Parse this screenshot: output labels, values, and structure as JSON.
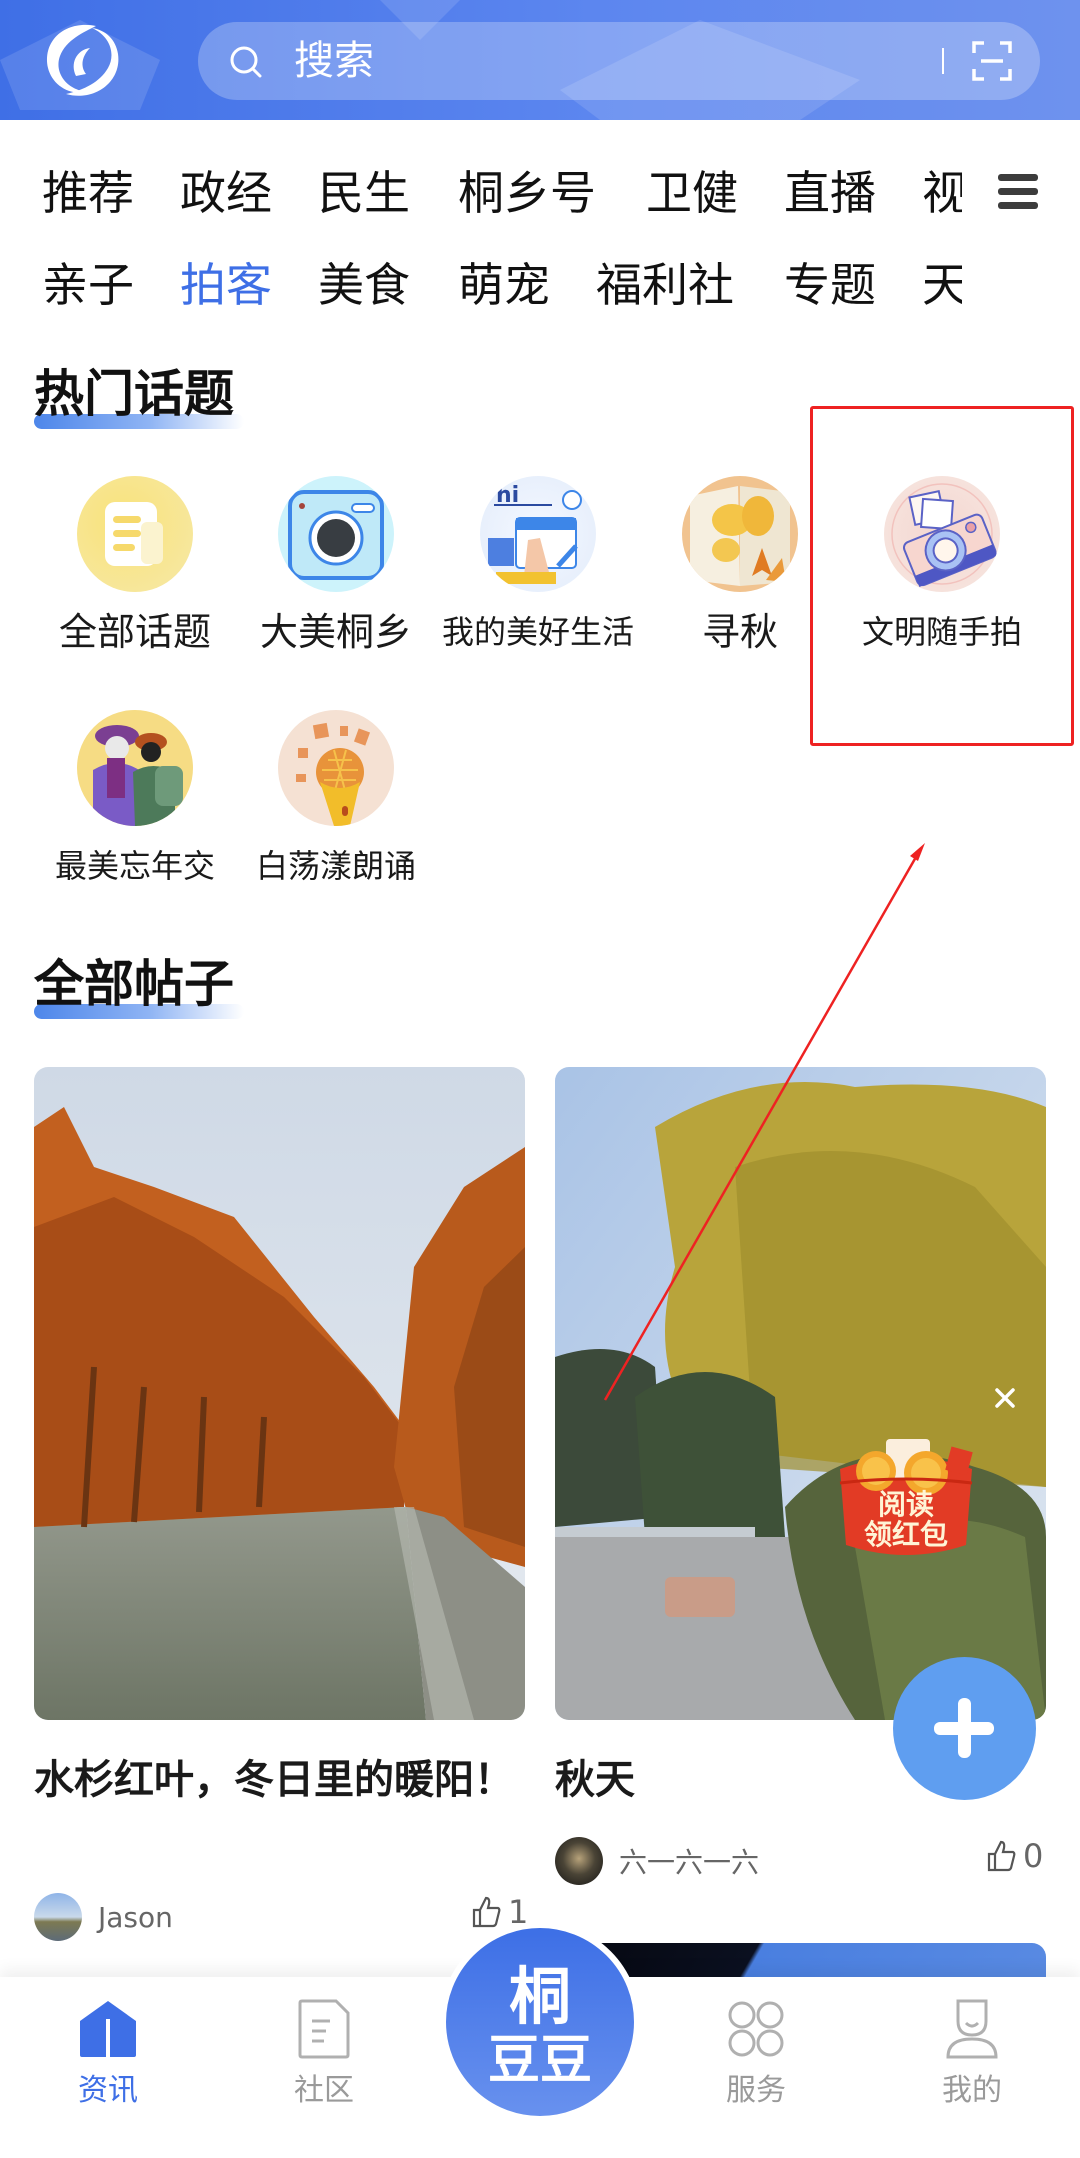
{
  "header": {
    "logo": "app-logo-swirl",
    "search_placeholder": "搜索",
    "scan_icon": "scan-icon"
  },
  "channels": {
    "row1": [
      "推荐",
      "政经",
      "民生",
      "桐乡号",
      "卫健",
      "直播",
      "视"
    ],
    "row2": [
      "亲子",
      "拍客",
      "美食",
      "萌宠",
      "福利社",
      "专题",
      "天"
    ],
    "active": "拍客",
    "menu_icon": "hamburger-menu-icon"
  },
  "hot_topics": {
    "title": "热门话题",
    "items": [
      {
        "label": "全部话题",
        "icon": "document-icon"
      },
      {
        "label": "大美桐乡",
        "icon": "camera-icon"
      },
      {
        "label": "我的美好生活",
        "icon": "calendar-illustration"
      },
      {
        "label": "寻秋",
        "icon": "autumn-leaves-book-illustration"
      },
      {
        "label": "文明随手拍",
        "icon": "vintage-camera-illustration"
      },
      {
        "label": "最美忘年交",
        "icon": "grandma-child-illustration"
      },
      {
        "label": "白荡漾朗诵",
        "icon": "microphone-illustration"
      }
    ],
    "highlighted": "文明随手拍"
  },
  "posts": {
    "title": "全部帖子",
    "items": [
      {
        "title": "水杉红叶，冬日里的暖阳！",
        "author": "Jason",
        "likes": "1",
        "image": "red-metasequoia-canal-photo"
      },
      {
        "title": "秋天",
        "author": "六一六一六",
        "likes": "0",
        "image": "autumn-ginkgo-park-photo"
      }
    ]
  },
  "floating": {
    "ad_line1": "阅读",
    "ad_line2": "领红包",
    "ad_close": "×",
    "fab": "add-post"
  },
  "bottom_nav": {
    "items": [
      {
        "label": "资讯",
        "icon": "home-icon",
        "active": true
      },
      {
        "label": "社区",
        "icon": "document-icon",
        "active": false
      },
      {
        "label": "",
        "icon": "tongdoudou-logo",
        "active": false
      },
      {
        "label": "服务",
        "icon": "grid-icon",
        "active": false
      },
      {
        "label": "我的",
        "icon": "profile-icon",
        "active": false
      }
    ],
    "center_text_top": "桐",
    "center_text_bottom": "豆豆"
  },
  "colors": {
    "brand": "#3e6fe6",
    "fab": "#5f9ef0",
    "annotation": "#ee2222"
  }
}
